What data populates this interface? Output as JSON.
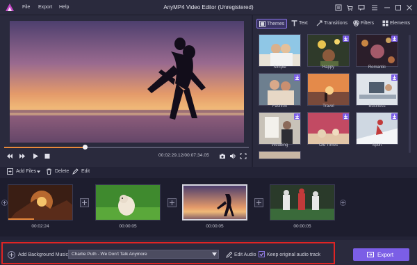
{
  "window": {
    "title": "AnyMP4 Video Editor (Unregistered)",
    "menu": [
      "File",
      "Export",
      "Help"
    ]
  },
  "player": {
    "time_current": "00:02:29.12",
    "time_total": "00:07:34.05",
    "time_separator": "/",
    "progress": 0.33
  },
  "tabs": [
    "Themes",
    "Text",
    "Transitions",
    "Filters",
    "Elements"
  ],
  "active_tab": "Themes",
  "themes": [
    {
      "label": "Simple",
      "downloaded": true
    },
    {
      "label": "Happy",
      "downloaded": false
    },
    {
      "label": "Romantic",
      "downloaded": false
    },
    {
      "label": "Fashion",
      "downloaded": false
    },
    {
      "label": "Travel",
      "downloaded": true
    },
    {
      "label": "Business",
      "downloaded": false
    },
    {
      "label": "Wedding",
      "downloaded": false
    },
    {
      "label": "Old Times",
      "downloaded": false
    },
    {
      "label": "Sport",
      "downloaded": false
    }
  ],
  "toolbar": {
    "add_files": "Add Files",
    "delete": "Delete",
    "edit": "Edit"
  },
  "timeline": {
    "clips": [
      {
        "duration": "00:02:24",
        "selected": false
      },
      {
        "duration": "00:00:05",
        "selected": false
      },
      {
        "duration": "00:00:05",
        "selected": true
      },
      {
        "duration": "00:00:05",
        "selected": false
      }
    ],
    "first_clip_progress": 0.4
  },
  "bottom": {
    "add_music_label": "Add Background Music:",
    "music_selected": "Charlie Puth - We Don't Talk Anymore",
    "edit_audio": "Edit Audio",
    "keep_original_audio": "Keep original audio track",
    "keep_original_checked": true,
    "export": "Export"
  },
  "colors": {
    "accent": "#7b5ee6",
    "progress": "#e8893a",
    "highlight_frame": "#e02424",
    "background": "#232336"
  }
}
